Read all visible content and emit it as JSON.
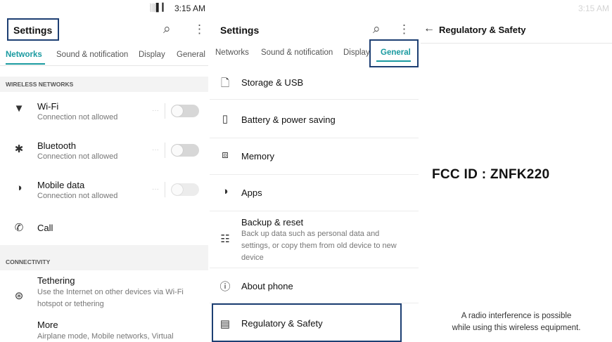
{
  "panel1": {
    "status": {
      "icons": "░▌▎",
      "time": "3:15 AM"
    },
    "title": "Settings",
    "tabs": [
      "Networks",
      "Sound & notification",
      "Display",
      "General"
    ],
    "active_tab": "Networks",
    "sections": {
      "wireless": "WIRELESS NETWORKS",
      "connectivity": "CONNECTIVITY"
    },
    "items": [
      {
        "title": "Wi-Fi",
        "subtitle": "Connection not allowed",
        "icon": "wifi-icon"
      },
      {
        "title": "Bluetooth",
        "subtitle": "Connection not allowed",
        "icon": "bluetooth-icon"
      },
      {
        "title": "Mobile data",
        "subtitle": "Connection not allowed",
        "icon": "mobile-data-icon"
      },
      {
        "title": "Call",
        "subtitle": "",
        "icon": "call-icon"
      },
      {
        "title": "Tethering",
        "subtitle_line1": "Use the Internet on other devices via Wi-Fi",
        "subtitle_line2": "hotspot or tethering",
        "icon": "tethering-icon"
      },
      {
        "title": "More",
        "subtitle": "Airplane mode, Mobile networks, Virtual"
      }
    ],
    "toggle_dots": "···"
  },
  "panel2": {
    "title": "Settings",
    "tabs": [
      "Networks",
      "Sound & notification",
      "Display",
      "General"
    ],
    "active_tab": "General",
    "items": [
      {
        "title": "Storage & USB",
        "icon": "storage-icon"
      },
      {
        "title": "Battery & power saving",
        "icon": "battery-icon"
      },
      {
        "title": "Memory",
        "icon": "memory-icon"
      },
      {
        "title": "Apps",
        "icon": "apps-icon"
      },
      {
        "title": "Backup & reset",
        "subtitle_line1": "Back up data such as personal data and",
        "subtitle_line2": "settings, or copy them from old device to new",
        "subtitle_line3": "device",
        "icon": "backup-icon"
      },
      {
        "title": "About phone",
        "icon": "about-icon"
      },
      {
        "title": "Regulatory & Safety",
        "icon": "regulatory-icon"
      }
    ]
  },
  "panel3": {
    "status": {
      "time": "3:15 AM"
    },
    "title": "Regulatory & Safety",
    "fcc_id": "FCC ID : ZNFK220",
    "note_line1": "A radio interference is possible",
    "note_line2": "while using this wireless equipment."
  },
  "colors": {
    "accent": "#1a9aa0",
    "highlight_box": "#1d3f73",
    "section_bg": "#f3f3f3"
  }
}
